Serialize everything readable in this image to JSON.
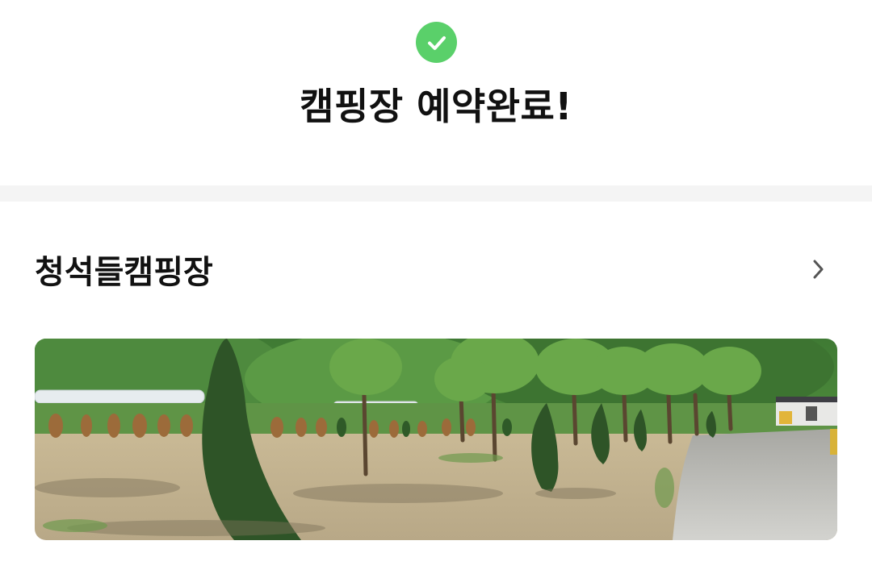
{
  "header": {
    "title": "캠핑장 예약완료!"
  },
  "camp": {
    "name": "청석들캠핑장"
  },
  "icons": {
    "success": "check-circle-icon",
    "navigate": "chevron-right-icon"
  },
  "colors": {
    "success": "#5ad06a",
    "title_text": "#111111",
    "divider": "#f4f4f4",
    "chevron": "#555555"
  }
}
